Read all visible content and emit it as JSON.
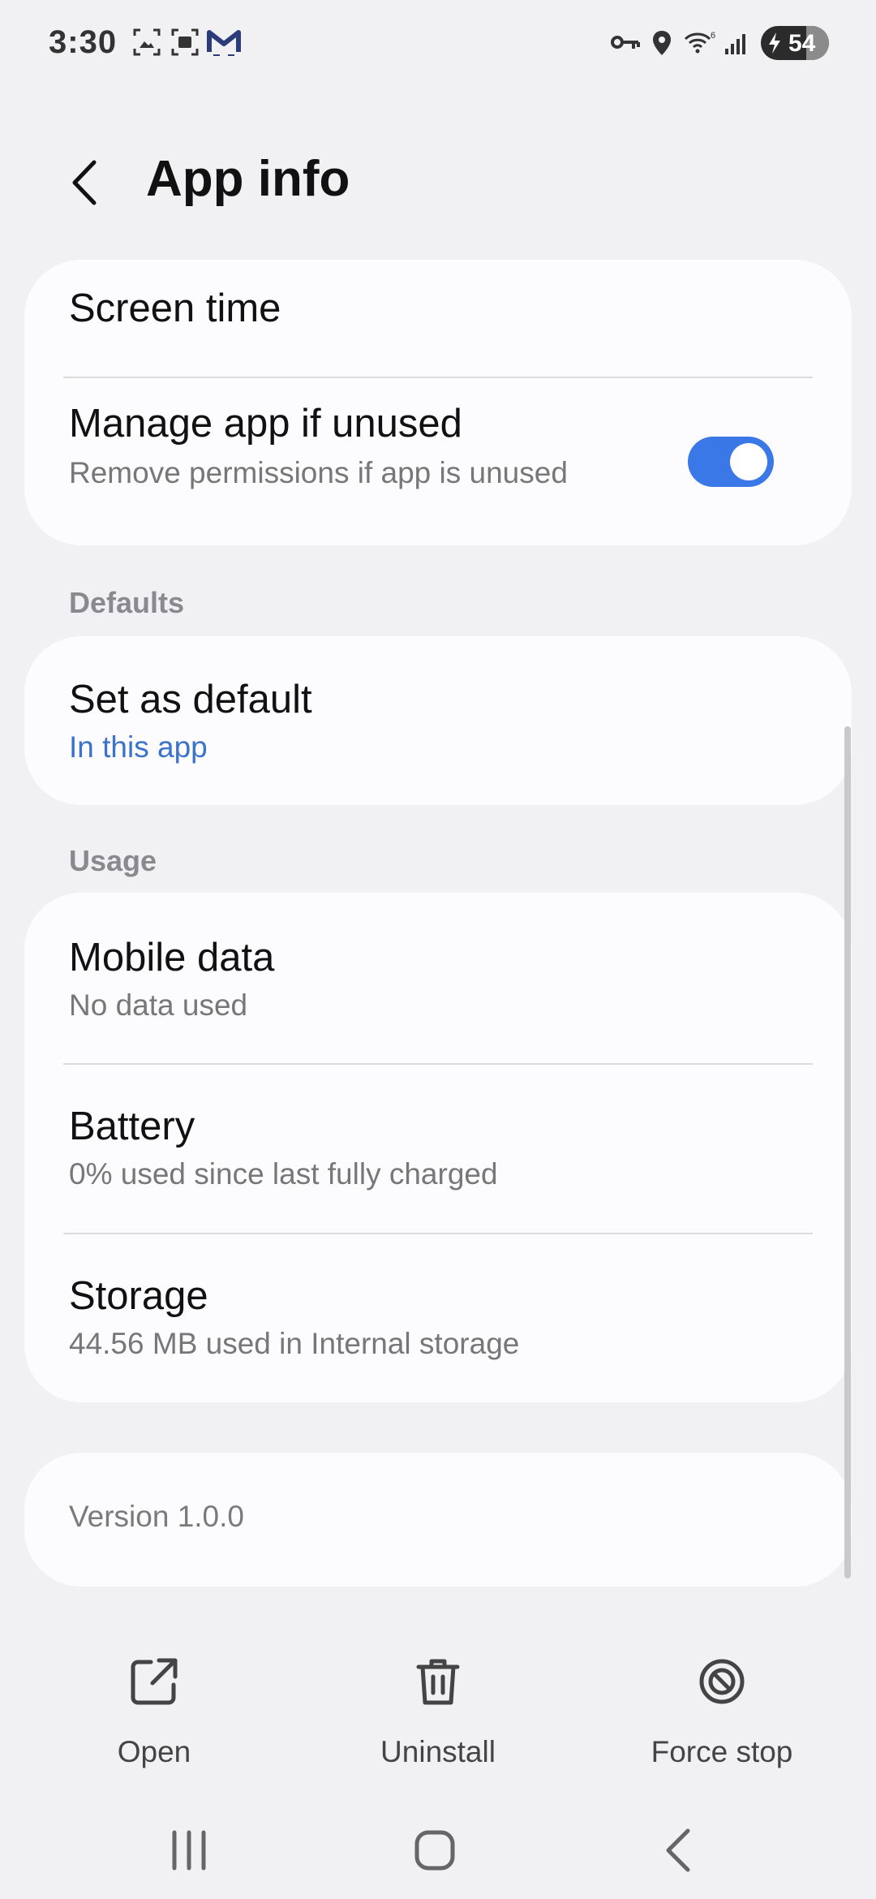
{
  "status_bar": {
    "time": "3:30",
    "battery_level": "54",
    "icons": [
      "screenshot-icon",
      "screen-record-icon",
      "gmail-icon",
      "vpn-key-icon",
      "location-icon",
      "wifi-icon",
      "signal-icon",
      "charging-battery-icon"
    ]
  },
  "header": {
    "title": "App info",
    "back_icon": "chevron-left-icon"
  },
  "card_top": {
    "screen_time": "Screen time",
    "manage_unused_title": "Manage app if unused",
    "manage_unused_subtitle": "Remove permissions if app is unused",
    "manage_unused_enabled": true
  },
  "defaults": {
    "header": "Defaults",
    "set_default_title": "Set as default",
    "set_default_subtitle": "In this app"
  },
  "usage": {
    "header": "Usage",
    "items": [
      {
        "title": "Mobile data",
        "subtitle": "No data used"
      },
      {
        "title": "Battery",
        "subtitle": "0% used since last fully charged"
      },
      {
        "title": "Storage",
        "subtitle": "44.56 MB used in Internal storage"
      }
    ]
  },
  "version": {
    "label": "Version 1.0.0"
  },
  "actions": [
    {
      "label": "Open",
      "icon": "open-external-icon"
    },
    {
      "label": "Uninstall",
      "icon": "trash-icon"
    },
    {
      "label": "Force stop",
      "icon": "stop-icon"
    }
  ],
  "navbar": {
    "icons": [
      "recents-icon",
      "home-icon",
      "back-icon"
    ]
  },
  "colors": {
    "background": "#f1f1f3",
    "card": "#fcfcfe",
    "accent": "#3b78e7",
    "link": "#3a73c9"
  }
}
